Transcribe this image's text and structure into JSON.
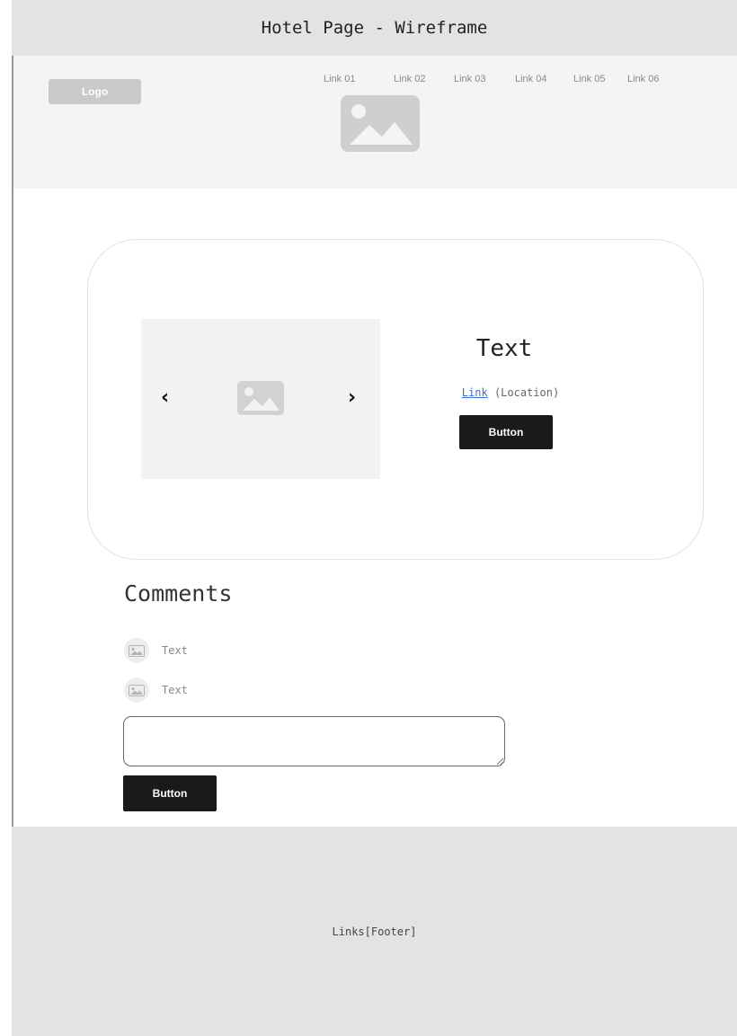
{
  "title_bar": {
    "title": "Hotel Page - Wireframe"
  },
  "header": {
    "logo": "Logo",
    "links": [
      "Link 01",
      "Link 02",
      "Link 03",
      "Link 04",
      "Link 05",
      "Link 06"
    ],
    "hero_image_icon": "image-placeholder-icon"
  },
  "card": {
    "carousel": {
      "prev_icon": "chevron-left-icon",
      "next_icon": "chevron-right-icon",
      "prev_glyph": "‹",
      "next_glyph": "›",
      "image_icon": "image-placeholder-icon"
    },
    "title": "Text",
    "link_label": "Link",
    "location_label": "(Location)",
    "button_label": "Button"
  },
  "comments": {
    "heading": "Comments",
    "items": [
      {
        "avatar_icon": "image-placeholder-icon",
        "text": "Text"
      },
      {
        "avatar_icon": "image-placeholder-icon",
        "text": "Text"
      }
    ],
    "input_value": "",
    "button_label": "Button"
  },
  "footer": {
    "text": "Links[Footer]"
  },
  "colors": {
    "frame_bg": "#e3e3e3",
    "nav_bg": "#f4f4f4",
    "button_bg": "#1a1a1a",
    "link": "#3b6fd4",
    "placeholder": "#cfcfcf"
  }
}
